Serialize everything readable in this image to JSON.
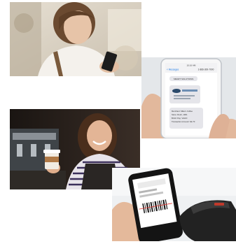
{
  "photos": [
    {
      "subject": "woman-looking-at-smartphone"
    },
    {
      "subject": "hand-holding-phone-with-text-messages"
    },
    {
      "subject": "smiling-barista-holding-coffee-cup"
    },
    {
      "subject": "phone-coupon-barcode-being-scanned"
    }
  ],
  "sms_screen": {
    "header_time": "10:16 AM",
    "header_back": "< Messages",
    "header_number": "1-866-300-7000",
    "bubble_1": "SMART SOLUTIONS",
    "bubble_3_lines": [
      "Merchant: Mike's Coffee",
      "Store: Rush, 1001",
      "BULK Pay: VALID",
      "Transaction Amount: $4.70"
    ]
  },
  "colors": {
    "cafe_bg": "#d8cfc0",
    "barista_bg": "#2a211d",
    "scanner_body": "#222222",
    "scanner_accent": "#c0392b"
  }
}
